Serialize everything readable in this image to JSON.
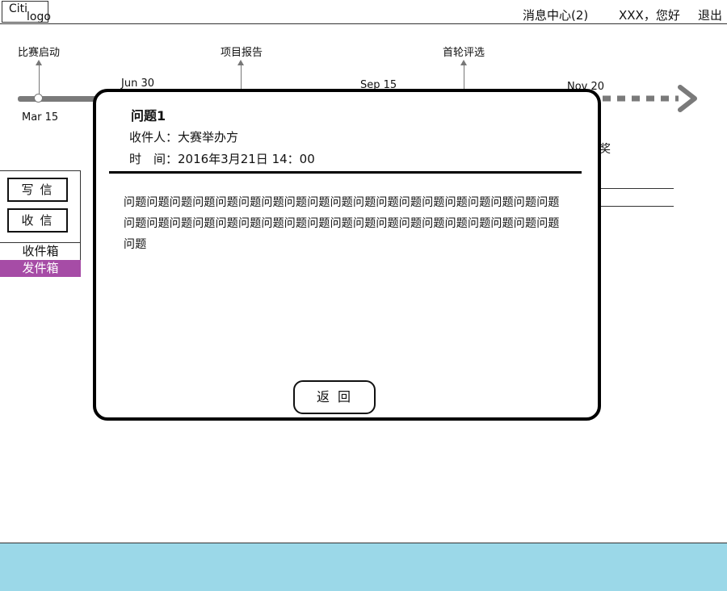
{
  "header": {
    "logo_line1": "Citi",
    "logo_line2": "logo",
    "messages": "消息中心(2)",
    "greeting": "XXX，您好",
    "logout": "退出"
  },
  "timeline": {
    "milestones": [
      "比赛启动",
      "项目报告",
      "首轮评选"
    ],
    "dates": [
      "Mar 15",
      "Jun 30",
      "Sep 15",
      "Nov 20"
    ],
    "partial_label": "奖"
  },
  "sidebar": {
    "write_label": "写信",
    "receive_label": "收信",
    "inbox_label": "收件箱",
    "outbox_label": "发件箱"
  },
  "modal": {
    "title": "问题1",
    "recipient": "收件人：大赛举办方",
    "time": "时　间：2016年3月21日 14：00",
    "body": "问题问题问题问题问题问题问题问题问题问题问题问题问题问题问题问题问题问题问题问题问题问题问题问题问题问题问题问题问题问题问题问题问题问题问题问题问题问题问题",
    "back_label": "返回"
  },
  "colors": {
    "accent": "#a64ca6",
    "footer": "#9bd8e8",
    "timeline": "#7a7a7a"
  }
}
